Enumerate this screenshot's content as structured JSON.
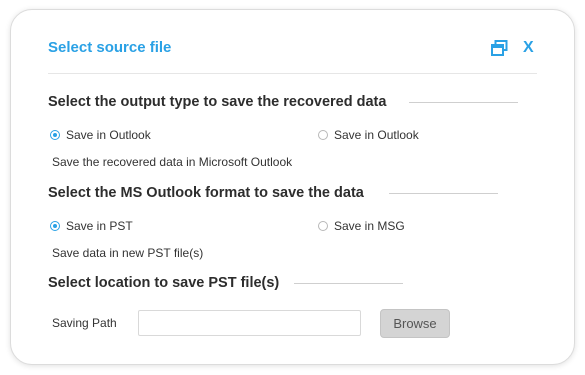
{
  "dialog": {
    "title": "Select source file",
    "close_label": "X"
  },
  "output_type": {
    "heading": "Select the output type to save the recovered data",
    "options": [
      {
        "label": "Save in Outlook",
        "checked": true
      },
      {
        "label": "Save in Outlook",
        "checked": false
      }
    ],
    "description": "Save the recovered data in Microsoft Outlook"
  },
  "outlook_format": {
    "heading": "Select the MS Outlook format to save the data",
    "options": [
      {
        "label": "Save in PST",
        "checked": true
      },
      {
        "label": "Save in MSG",
        "checked": false
      }
    ],
    "description": "Save data in new PST file(s)"
  },
  "location": {
    "heading": "Select location to save PST file(s)",
    "path_label": "Saving Path",
    "path_value": "",
    "browse_label": "Browse"
  },
  "colors": {
    "accent": "#2aa1e5",
    "browse_bg": "#d4d4d4"
  }
}
